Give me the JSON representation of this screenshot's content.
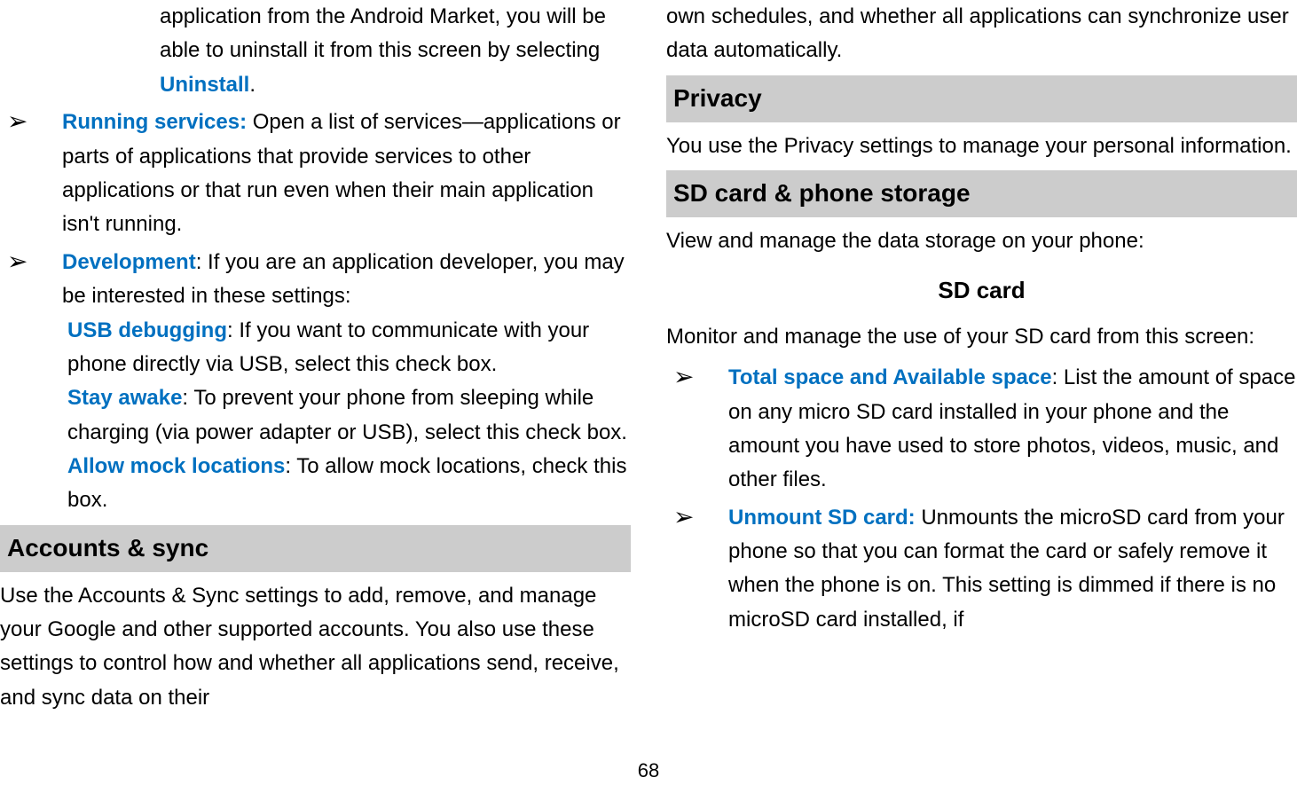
{
  "left": {
    "continuation": {
      "text1": "application from the Android Market, you will be able to uninstall it from this screen by selecting ",
      "uninstall": "Uninstall",
      "text2": "."
    },
    "running_services": {
      "label": "Running services:",
      "text": " Open a list of services—applications or parts of applications that provide services to other applications or that run even when their main application isn't running."
    },
    "development": {
      "label": "Development",
      "text": ": If you are an application developer, you may be interested in these settings:",
      "usb_label": "USB debugging",
      "usb_text": ": If you want to communicate with your phone directly via USB, select this check box.",
      "stay_label": "Stay awake",
      "stay_text": ": To prevent your phone from sleeping while charging (via power adapter or USB), select this check box.",
      "mock_label": "Allow mock locations",
      "mock_text": ": To allow mock locations, check this box."
    },
    "accounts_heading": "Accounts & sync",
    "accounts_text": "Use the Accounts & Sync settings to add, remove, and manage your Google and other supported accounts. You also use these settings to control how and whether all applications send, receive, and sync data on their"
  },
  "right": {
    "continuation": "own schedules, and whether all applications can synchronize user data automatically.",
    "privacy_heading": "Privacy",
    "privacy_text": "You use the Privacy settings to manage your personal information.",
    "storage_heading": "SD card & phone storage",
    "storage_text": "View and manage the data storage on your phone:",
    "sdcard_heading": "SD card",
    "sdcard_text": "Monitor and manage the use of your SD card from this screen:",
    "total_label": "Total space and Available space",
    "total_text": ": List the amount of space on any micro SD card installed in your phone and the amount you have used to store photos, videos, music, and other files.",
    "unmount_label": "Unmount SD card:",
    "unmount_text": " Unmounts the microSD card from your phone so that you can format the card or safely remove it when the phone is on. This setting is dimmed if there is no microSD card installed, if"
  },
  "page_number": "68",
  "bullet": "➢"
}
